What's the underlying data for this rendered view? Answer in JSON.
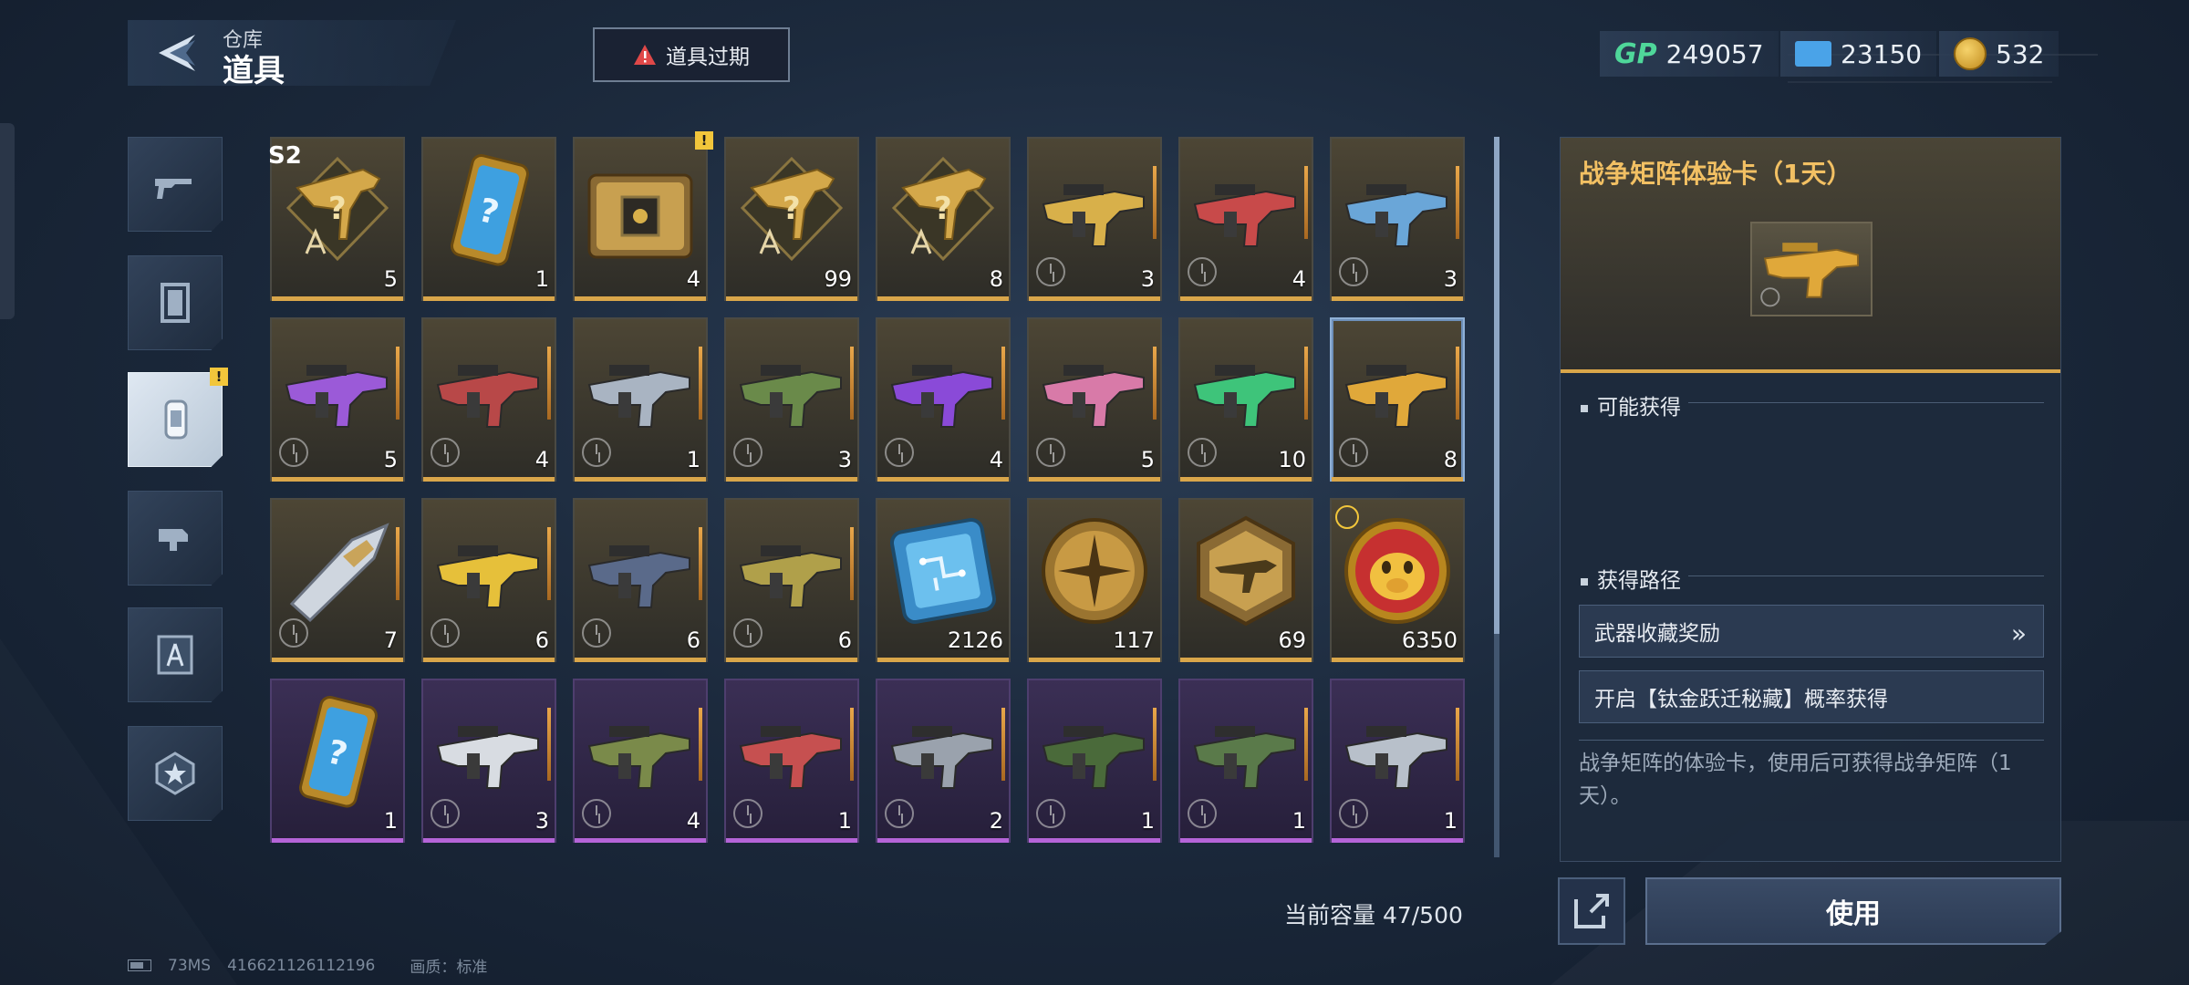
{
  "header": {
    "breadcrumb": "仓库",
    "title": "道具",
    "expire_label": "道具过期"
  },
  "currency": {
    "gp": {
      "label": "GP",
      "value": "249057"
    },
    "tickets": {
      "value": "23150"
    },
    "coins": {
      "value": "532"
    }
  },
  "sidebar": {
    "tabs": [
      {
        "icon": "gun-icon",
        "active": false
      },
      {
        "icon": "card-frame-icon",
        "active": false
      },
      {
        "icon": "item-card-icon",
        "active": true,
        "badge": "!"
      },
      {
        "icon": "attachment-icon",
        "active": false
      },
      {
        "icon": "blueprint-icon",
        "active": false
      },
      {
        "icon": "star-emblem-icon",
        "active": false
      }
    ]
  },
  "grid": {
    "season_tag": "S2",
    "new_badge": "!",
    "items": [
      {
        "name": "blueprint-gold-rifle",
        "count": "5",
        "rarity": "gold",
        "art": "blueprint"
      },
      {
        "name": "mystery-card",
        "count": "1",
        "rarity": "gold",
        "art": "card"
      },
      {
        "name": "crate",
        "count": "4",
        "rarity": "gold",
        "art": "crate"
      },
      {
        "name": "blueprint-gold-rifle-2",
        "count": "99",
        "rarity": "gold",
        "art": "blueprint"
      },
      {
        "name": "blueprint-gold-rifle-3",
        "count": "8",
        "rarity": "gold",
        "art": "blueprint"
      },
      {
        "name": "trial-gun-gold",
        "count": "3",
        "rarity": "gold",
        "art": "gun",
        "color": "#d8b04a"
      },
      {
        "name": "trial-gun-red",
        "count": "4",
        "rarity": "gold",
        "art": "gun",
        "color": "#c84a4a"
      },
      {
        "name": "trial-gun-blue",
        "count": "3",
        "rarity": "gold",
        "art": "gun",
        "color": "#6aa6d8"
      },
      {
        "name": "trial-gun-purple",
        "count": "5",
        "rarity": "gold",
        "art": "gun",
        "color": "#9b5ad8"
      },
      {
        "name": "trial-gun-red-2",
        "count": "4",
        "rarity": "gold",
        "art": "gun",
        "color": "#b84848"
      },
      {
        "name": "trial-gun-silver",
        "count": "1",
        "rarity": "gold",
        "art": "gun",
        "color": "#a9b4c2"
      },
      {
        "name": "trial-gun-green",
        "count": "3",
        "rarity": "gold",
        "art": "gun",
        "color": "#6a8a4a"
      },
      {
        "name": "trial-gun-violet",
        "count": "4",
        "rarity": "gold",
        "art": "gun",
        "color": "#8a4ad8"
      },
      {
        "name": "trial-gun-pink",
        "count": "5",
        "rarity": "gold",
        "art": "gun",
        "color": "#d87aa8"
      },
      {
        "name": "trial-gun-emerald",
        "count": "10",
        "rarity": "gold",
        "art": "gun",
        "color": "#3ec47a"
      },
      {
        "name": "trial-gun-war-matrix",
        "count": "8",
        "rarity": "gold",
        "art": "gun",
        "color": "#e0a83a",
        "selected": true
      },
      {
        "name": "trial-knife",
        "count": "7",
        "rarity": "gold",
        "art": "knife",
        "color": "#c9a45a"
      },
      {
        "name": "trial-gun-yellow",
        "count": "6",
        "rarity": "gold",
        "art": "gun",
        "color": "#e6c03a"
      },
      {
        "name": "trial-gun-dark",
        "count": "6",
        "rarity": "gold",
        "art": "gun",
        "color": "#5a6a8a"
      },
      {
        "name": "trial-gun-camo",
        "count": "6",
        "rarity": "gold",
        "art": "gun",
        "color": "#b0a04a"
      },
      {
        "name": "chip",
        "count": "2126",
        "rarity": "gold",
        "art": "chip"
      },
      {
        "name": "gold-medal",
        "count": "117",
        "rarity": "gold",
        "art": "medal"
      },
      {
        "name": "hex-badge",
        "count": "69",
        "rarity": "gold",
        "art": "hex"
      },
      {
        "name": "pig-token",
        "count": "6350",
        "rarity": "gold",
        "art": "pig",
        "timer": true
      },
      {
        "name": "mystery-card-2",
        "count": "1",
        "rarity": "purple",
        "art": "card"
      },
      {
        "name": "trial-smg-white",
        "count": "3",
        "rarity": "purple",
        "art": "gun",
        "color": "#d8dce2"
      },
      {
        "name": "trial-gun-olive",
        "count": "4",
        "rarity": "purple",
        "art": "gun",
        "color": "#7a8a4a"
      },
      {
        "name": "trial-gun-red-3",
        "count": "1",
        "rarity": "purple",
        "art": "gun",
        "color": "#c65050"
      },
      {
        "name": "trial-gun-gray",
        "count": "2",
        "rarity": "purple",
        "art": "gun",
        "color": "#9aa2ad"
      },
      {
        "name": "trial-gun-forest",
        "count": "1",
        "rarity": "purple",
        "art": "gun",
        "color": "#4a6a3a"
      },
      {
        "name": "trial-gun-moss",
        "count": "1",
        "rarity": "purple",
        "art": "gun",
        "color": "#5a7a4a"
      },
      {
        "name": "trial-pistol-silver",
        "count": "1",
        "rarity": "purple",
        "art": "gun",
        "color": "#b8c0ca"
      }
    ]
  },
  "capacity": {
    "label": "当前容量 47/500"
  },
  "detail": {
    "title": "战争矩阵体验卡（1天）",
    "obtain_title": "可能获得",
    "route_title": "获得路径",
    "routes": [
      {
        "label": "武器收藏奖励",
        "has_arrow": true
      },
      {
        "label": "开启【钛金跃迁秘藏】概率获得",
        "has_arrow": false
      }
    ],
    "arrow_glyph": "»",
    "description": "战争矩阵的体验卡，使用后可获得战争矩阵（1天）。",
    "use_label": "使用"
  },
  "footer": {
    "ping": "73MS",
    "uid": "416621126112196",
    "quality": "画质：标准"
  },
  "colors": {
    "gold_bar": "#d9a64a",
    "purple_bar": "#b564d8",
    "accent_title": "#f2c063",
    "gp_green": "#4fd79a"
  }
}
